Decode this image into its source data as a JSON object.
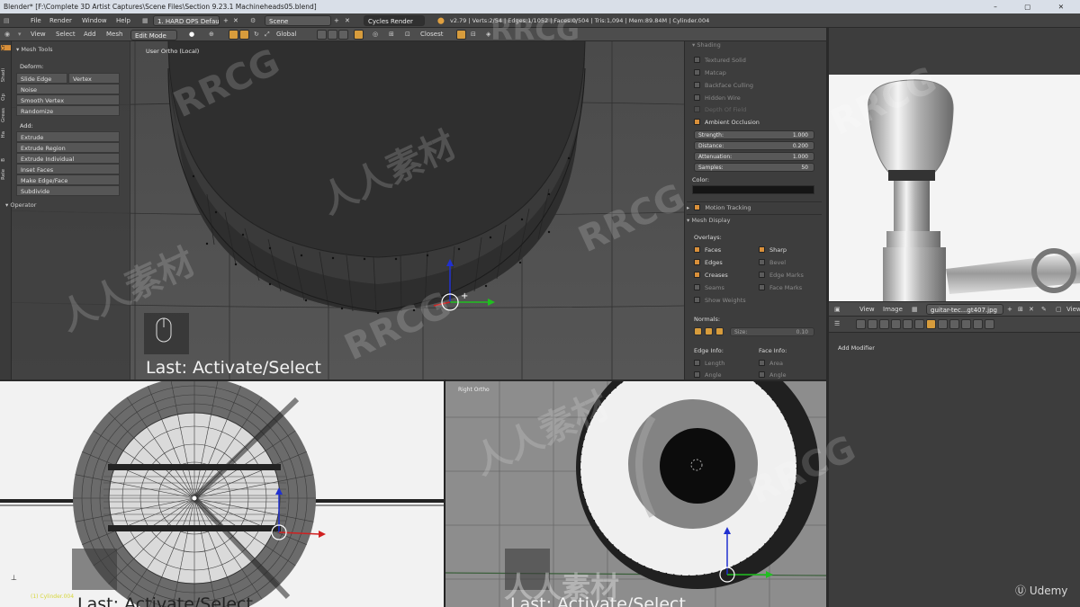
{
  "window": {
    "title": "Blender* [F:\\Complete 3D Artist Captures\\Scene Files\\Section 9.23.1 Machineheads05.blend]",
    "controls": [
      "–",
      "▢",
      "✕"
    ]
  },
  "info_header": {
    "menus": [
      "File",
      "Render",
      "Window",
      "Help"
    ],
    "screen_layout": "1. HARD OPS Default",
    "scene": "Scene",
    "render_engine": "Cycles Render",
    "stats": "v2.79 | Verts:2/54 | Edges:1/1052 | Faces:0/504 | Tris:1,094 | Mem:89.84M | Cylinder.004"
  },
  "viewport_header": {
    "menus": [
      "View",
      "Select",
      "Add",
      "Mesh"
    ],
    "mode": "Edit Mode",
    "orientation": "Global",
    "snap_target": "Closest"
  },
  "main_viewport": {
    "view_label": "User Ortho (Local)",
    "last_operator": "Last: Activate/Select"
  },
  "tool_shelf": {
    "tabs": [
      "Cr",
      "Shadi",
      "Op",
      "Greas",
      "Ha",
      "B",
      "Rele"
    ],
    "panel_title": "Mesh Tools",
    "deform_label": "Deform:",
    "deform_items": [
      "Slide Edge",
      "Vertex",
      "Noise",
      "Smooth Vertex",
      "Randomize"
    ],
    "add_label": "Add:",
    "add_items": [
      "Extrude",
      "Extrude Region",
      "Extrude Individual",
      "Inset Faces",
      "Make Edge/Face",
      "Subdivide"
    ],
    "operator_panel": "Operator"
  },
  "properties": {
    "shading_title": "Shading",
    "shading_options": [
      "Textured Solid",
      "Matcap",
      "Backface Culling",
      "Hidden Wire",
      "Depth Of Field"
    ],
    "ambient_occlusion": "Ambient Occlusion",
    "ao_fields": [
      {
        "label": "Strength:",
        "value": "1.000"
      },
      {
        "label": "Distance:",
        "value": "0.200"
      },
      {
        "label": "Attenuation:",
        "value": "1.000"
      },
      {
        "label": "Samples:",
        "value": "50"
      }
    ],
    "color_label": "Color:",
    "motion_tracking": "Motion Tracking",
    "mesh_display_title": "Mesh Display",
    "overlays_label": "Overlays:",
    "overlays_left": [
      {
        "label": "Faces",
        "on": true
      },
      {
        "label": "Edges",
        "on": true
      },
      {
        "label": "Creases",
        "on": true
      },
      {
        "label": "Seams",
        "on": false
      },
      {
        "label": "Show Weights",
        "on": false
      }
    ],
    "overlays_right": [
      {
        "label": "Sharp",
        "on": true
      },
      {
        "label": "Bevel",
        "on": false
      },
      {
        "label": "Edge Marks",
        "on": false
      },
      {
        "label": "Face Marks",
        "on": false
      }
    ],
    "normals_label": "Normals:",
    "normals_size": "Size:",
    "normals_size_value": "0.10",
    "edge_info_label": "Edge Info:",
    "face_info_label": "Face Info:",
    "edge_info_items": [
      "Length",
      "Angle"
    ],
    "face_info_items": [
      "Area",
      "Angle"
    ]
  },
  "image_editor": {
    "menus": [
      "View",
      "Image"
    ],
    "image_name": "guitar-tec...gt407.jpg",
    "right_label": "View"
  },
  "modifiers": {
    "add_modifier": "Add Modifier"
  },
  "bottom_left": {
    "status": "(1) Cylinder.004",
    "last_operator": "Last: Activate/Select"
  },
  "bottom_right": {
    "view_label": "Right Ortho",
    "last_operator": "Last: Activate/Select"
  },
  "watermarks": {
    "rrcg": "RRCG",
    "cn": "人人素材",
    "udemy": "Udemy"
  },
  "colors": {
    "accent_orange": "#d9903a",
    "axis_x": "#d02020",
    "axis_y": "#20c020",
    "axis_z": "#2030d0"
  }
}
